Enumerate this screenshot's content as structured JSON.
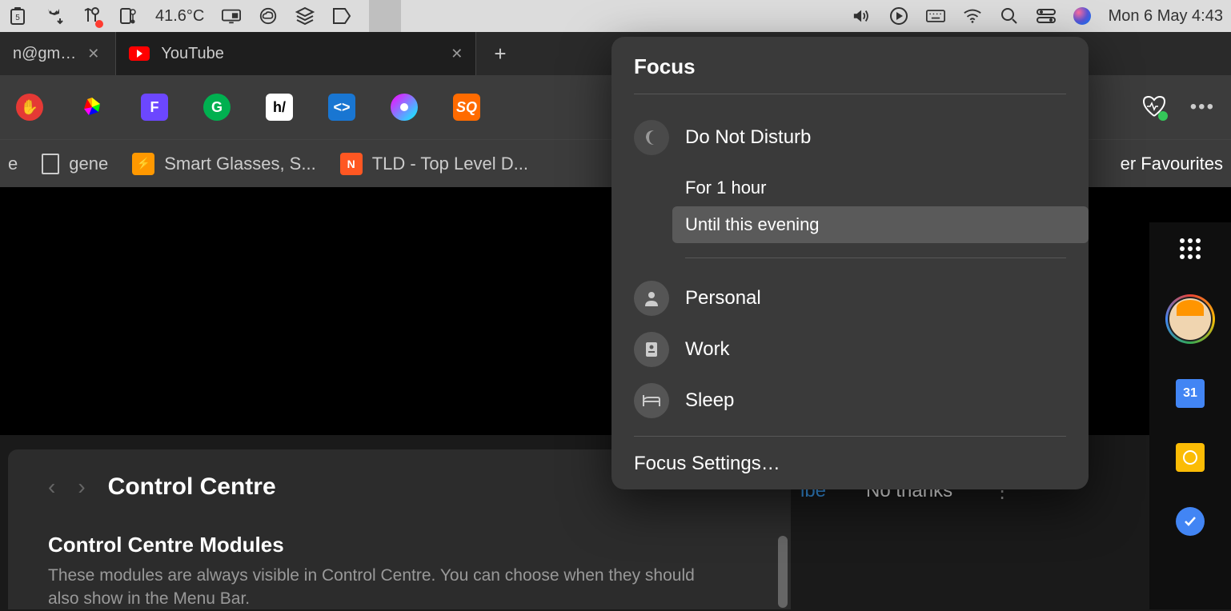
{
  "menubar": {
    "temperature": "41.6°C",
    "clock": "Mon 6 May  4:43"
  },
  "tabs": [
    {
      "title": "n@gm…"
    },
    {
      "title": "YouTube"
    }
  ],
  "bookmarks": {
    "items": [
      {
        "icon": "doc",
        "label": "e"
      },
      {
        "icon": "doc",
        "label": "gene"
      },
      {
        "icon": "sg",
        "label": "Smart Glasses, S..."
      },
      {
        "icon": "tld",
        "label": "TLD - Top Level D..."
      }
    ],
    "right_label": "er Favourites"
  },
  "right_sidebar": {
    "calendar_day": "31"
  },
  "subscribe": {
    "ibe": "ibe",
    "no_thanks": "No thanks"
  },
  "focus": {
    "title": "Focus",
    "dnd": "Do Not Disturb",
    "for_1_hour": "For 1 hour",
    "until_evening": "Until this evening",
    "personal": "Personal",
    "work": "Work",
    "sleep": "Sleep",
    "settings": "Focus Settings…"
  },
  "control_centre": {
    "title": "Control Centre",
    "section_title": "Control Centre Modules",
    "section_desc": "These modules are always visible in Control Centre. You can choose when they should also show in the Menu Bar."
  }
}
